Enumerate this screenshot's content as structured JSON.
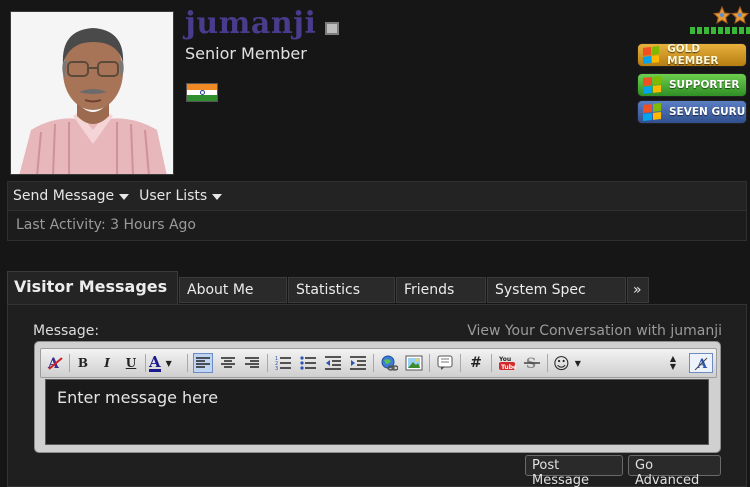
{
  "profile": {
    "username": "jumanji",
    "user_title": "Senior Member",
    "flag": "India",
    "online_status_icon": "offline-status-icon",
    "rank_icon": "two-stars-icon",
    "reputation_bar_segments": 10,
    "badges": [
      {
        "label": "GOLD MEMBER",
        "color": "#d79a22"
      },
      {
        "label": "SUPPORTER",
        "color": "#46ac36"
      },
      {
        "label": "SEVEN GURU",
        "color": "#4366a8"
      }
    ]
  },
  "actions": {
    "send_message": "Send Message",
    "user_lists": "User Lists"
  },
  "activity": {
    "label": "Last Activity:",
    "value": "3 Hours Ago"
  },
  "tabs": [
    {
      "label": "Visitor Messages",
      "active": true
    },
    {
      "label": "About Me"
    },
    {
      "label": "Statistics"
    },
    {
      "label": "Friends"
    },
    {
      "label": "System Spec"
    },
    {
      "label": "»"
    }
  ],
  "message": {
    "label": "Message:",
    "conversation_link": "View Your Conversation with jumanji",
    "placeholder": "Enter message here",
    "post_button": "Post Message",
    "advanced_button": "Go Advanced"
  },
  "toolbar": {
    "bold": "B",
    "italic": "I",
    "underline": "U",
    "font_color": "A",
    "hash": "#",
    "smilie": "☺"
  },
  "colors": {
    "username": "#4a3c8c",
    "background": "#161616"
  }
}
